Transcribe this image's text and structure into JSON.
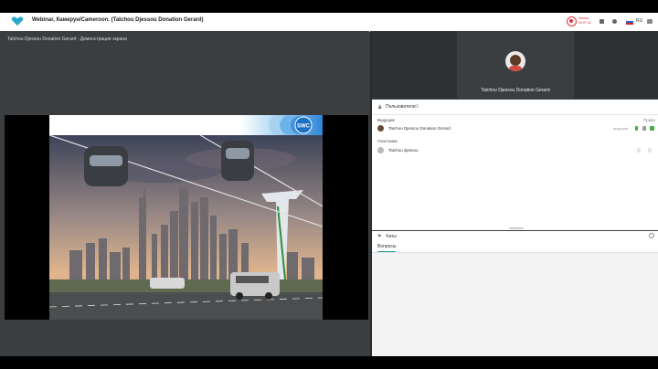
{
  "header": {
    "title": "Webinar, Камерун/Cameroon. (Tatchou Djessou Donation Gerard)",
    "record_label": "Запись",
    "record_time": "00:07:34",
    "language": "RU"
  },
  "screen_share": {
    "caption": "Tatchou Djessou Donation Gerard - Демонстрация экрана",
    "slide_logo_text": "SWC"
  },
  "video": {
    "name": "Tatchou Djessou Donation Gerard"
  },
  "participants": {
    "title": "Пользователи",
    "count": "3",
    "rights_label": "Права",
    "hosts_label": "Ведущие",
    "participants_label": "Участники",
    "host": {
      "name": "Tatchou Djessou Donation Gerard",
      "role": "ведущие"
    },
    "participant": {
      "name": "Tatchou djessou"
    }
  },
  "chat": {
    "title": "Чаты",
    "tab": "Вопросы"
  },
  "colors": {
    "accent": "#1a9b8f",
    "record": "#e2353b",
    "mic_on": "#3fae49"
  }
}
